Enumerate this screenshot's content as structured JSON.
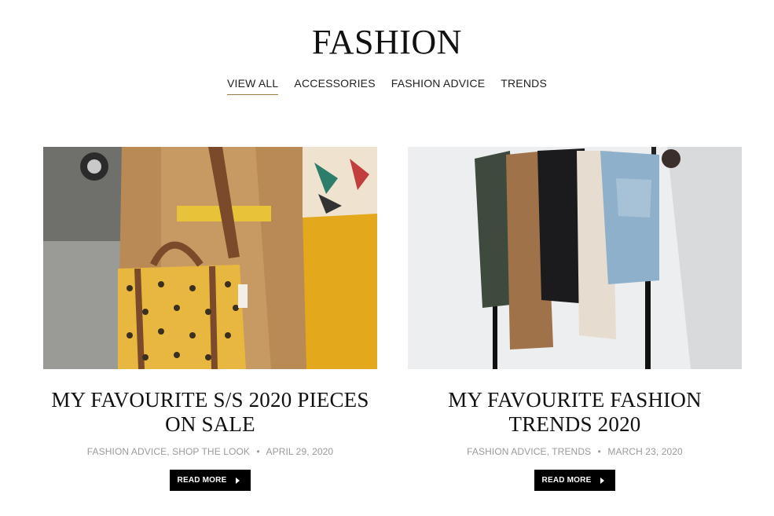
{
  "page": {
    "title": "FASHION"
  },
  "tabs": [
    {
      "label": "VIEW ALL",
      "active": true
    },
    {
      "label": "ACCESSORIES",
      "active": false
    },
    {
      "label": "FASHION ADVICE",
      "active": false
    },
    {
      "label": "TRENDS",
      "active": false
    }
  ],
  "posts": [
    {
      "title": "MY FAVOURITE S/S 2020 PIECES ON SALE",
      "categories": [
        "FASHION ADVICE",
        "SHOP THE LOOK"
      ],
      "date": "APRIL 29, 2020",
      "read_more": "READ MORE"
    },
    {
      "title": "MY FAVOURITE FASHION TRENDS 2020",
      "categories": [
        "FASHION ADVICE",
        "TRENDS"
      ],
      "date": "MARCH 23, 2020",
      "read_more": "READ MORE"
    }
  ],
  "colors": {
    "tab_underline": "#a07a47",
    "meta_text": "#9a9a9a",
    "button_bg": "#000000"
  },
  "icons": {
    "read_more_arrow": "caret-right-icon"
  }
}
